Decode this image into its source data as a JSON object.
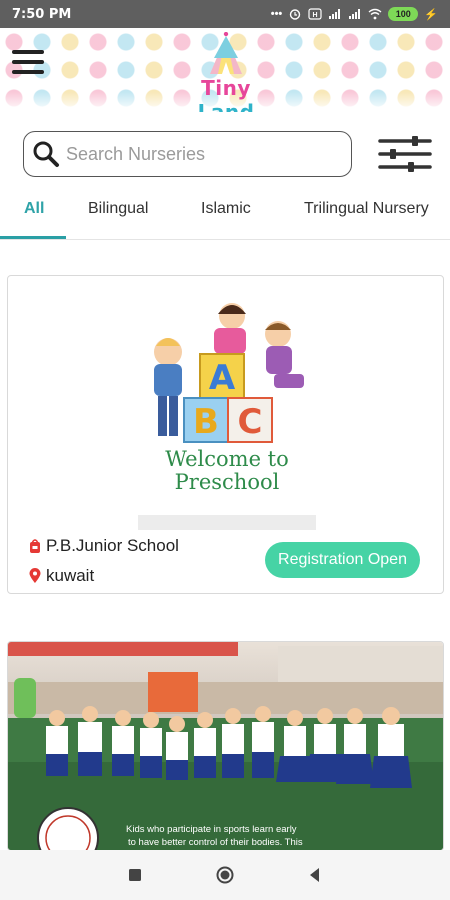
{
  "status_bar": {
    "time": "7:50 PM",
    "icons": [
      "more-dots-icon",
      "alarm-icon",
      "data-icon",
      "signal-4g-icon",
      "signal-icon",
      "wifi-icon"
    ],
    "battery": "100"
  },
  "header": {
    "logo_word1": "Tiny",
    "logo_word2": "Land",
    "menu_icon": "hamburger-menu-icon"
  },
  "search": {
    "placeholder": "Search Nurseries",
    "icon": "search-icon",
    "filter_icon": "sliders-filter-icon"
  },
  "tabs": [
    {
      "label": "All",
      "active": true
    },
    {
      "label": "Bilingual",
      "active": false
    },
    {
      "label": "Islamic",
      "active": false
    },
    {
      "label": "Trilingual Nursery",
      "active": false
    }
  ],
  "listings": [
    {
      "image_caption_line1": "Welcome to",
      "image_caption_line2": "Preschool",
      "blocks": [
        "A",
        "B",
        "C"
      ],
      "name": "P.B.Junior School",
      "location": "kuwait",
      "badge": "Registration Open"
    },
    {
      "image_caption_line1": "Kids who participate in sports learn early",
      "image_caption_line2": "to have better control of their bodies. This"
    }
  ],
  "colors": {
    "accent": "#2fa3a8",
    "badge": "#46d3a5",
    "pin": "#e53935"
  },
  "nav_bar": [
    "recent-apps-icon",
    "home-icon",
    "back-icon"
  ]
}
